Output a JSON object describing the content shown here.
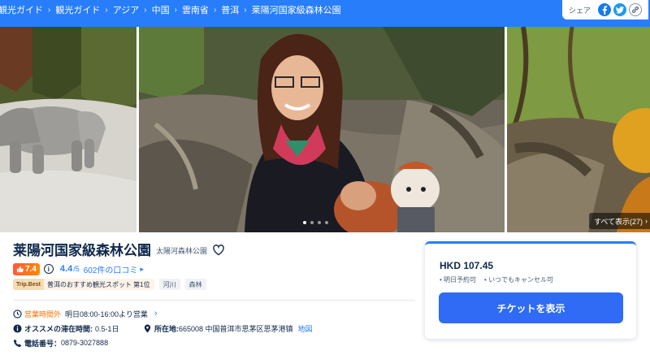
{
  "breadcrumb": [
    "観光ガイド",
    "観光ガイド",
    "アジア",
    "中国",
    "雲南省",
    "普洱",
    "莱陽河国家級森林公園"
  ],
  "share": {
    "label": "シェア",
    "icons": [
      "facebook-icon",
      "twitter-icon",
      "link-icon"
    ]
  },
  "gallery": {
    "view_all": "すべて表示(27)",
    "dot_count": 4,
    "active_dot": 0
  },
  "attraction": {
    "title": "莱陽河国家級森林公園",
    "subtitle": "太陽河森林公園",
    "hot_score": "7.4",
    "rating": "4.4",
    "rating_max": "/5",
    "reviews": "602件の口コミ",
    "best_logo": "Trip.Best",
    "best_text": "普洱のおすすめ観光スポット 第1位",
    "tags": [
      "河川",
      "森林"
    ]
  },
  "details": {
    "hours_label": "営業時間外",
    "hours_value": "明日08:00-16:00より営業",
    "stay_label": "オススメの滞在時間:",
    "stay_value": "0.5-1日",
    "address_label": "所在地:",
    "address_value": "665008 中国普洱市思茅区思茅港镇",
    "map_link": "地図",
    "phone_label": "電話番号：",
    "phone_value": "0879-3027888"
  },
  "ticket": {
    "price": "HKD 107.45",
    "perks": [
      "明日予約可",
      "いつでもキャンセル可"
    ],
    "button": "チケットを表示"
  },
  "colors": {
    "brand": "#287dfa",
    "button": "#2f6bf5",
    "hot": "#ff6f00"
  }
}
